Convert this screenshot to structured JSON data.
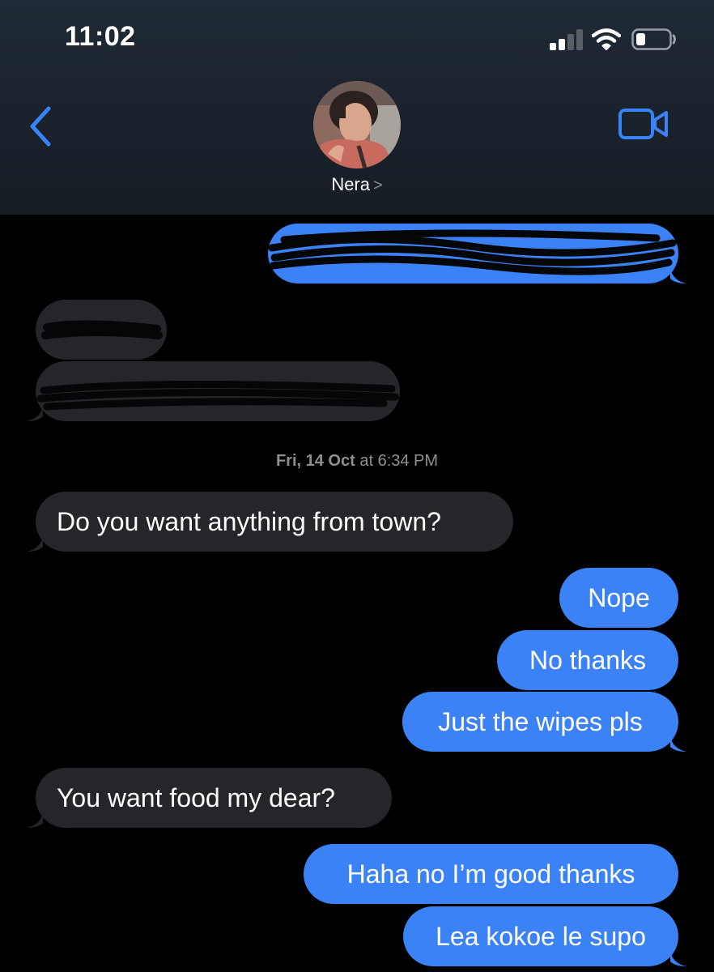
{
  "status_bar": {
    "time": "11:02"
  },
  "header": {
    "contact_name": "Nera",
    "name_chevron": ">"
  },
  "conversation": {
    "timestamp_day": "Fri, 14 Oct",
    "timestamp_time": "at 6:34 PM",
    "messages": [
      {
        "direction": "outgoing",
        "text": ""
      },
      {
        "direction": "incoming",
        "text": ""
      },
      {
        "direction": "incoming",
        "text": ""
      },
      {
        "direction": "incoming",
        "text": "Do you want anything from town?"
      },
      {
        "direction": "outgoing",
        "text": "Nope"
      },
      {
        "direction": "outgoing",
        "text": "No thanks"
      },
      {
        "direction": "outgoing",
        "text": "Just the wipes pls"
      },
      {
        "direction": "incoming",
        "text": "You want food my dear?"
      },
      {
        "direction": "outgoing",
        "text": "Haha no I’m good thanks"
      },
      {
        "direction": "outgoing",
        "text": "Lea kokoe le supo"
      }
    ]
  },
  "colors": {
    "outgoing_bubble": "#3b82f6",
    "incoming_bubble": "#26252a",
    "accent": "#3a82f7",
    "background": "#000000"
  },
  "icons": {
    "back": "chevron-left-icon",
    "video": "video-camera-icon",
    "signal": "cellular-signal-icon",
    "wifi": "wifi-icon",
    "battery": "battery-icon"
  }
}
